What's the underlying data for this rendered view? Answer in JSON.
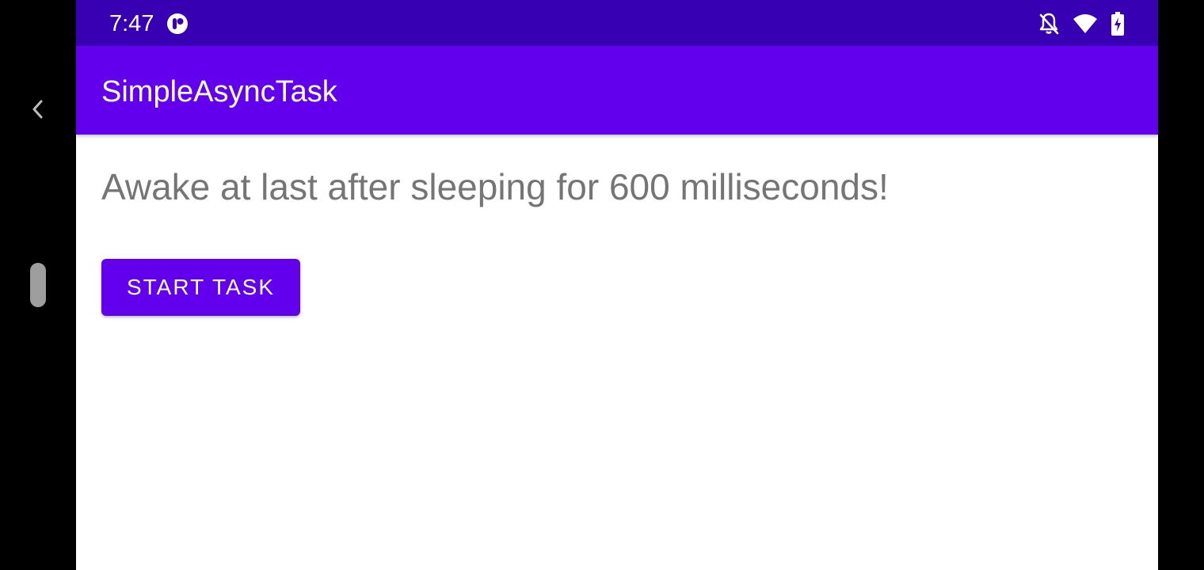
{
  "status_bar": {
    "time": "7:47",
    "app_icon": "circle-app-icon",
    "icons": [
      "notifications-off-icon",
      "wifi-icon",
      "battery-charging-icon"
    ],
    "color": "#3700b3"
  },
  "toolbar": {
    "title": "SimpleAsyncTask",
    "color": "#6200ee"
  },
  "main": {
    "result_text": "Awake at last after sleeping for 600 milliseconds!",
    "start_button_label": "START TASK"
  },
  "navigation": {
    "back_icon": "chevron-left-icon",
    "home_handle": "home-pill"
  }
}
